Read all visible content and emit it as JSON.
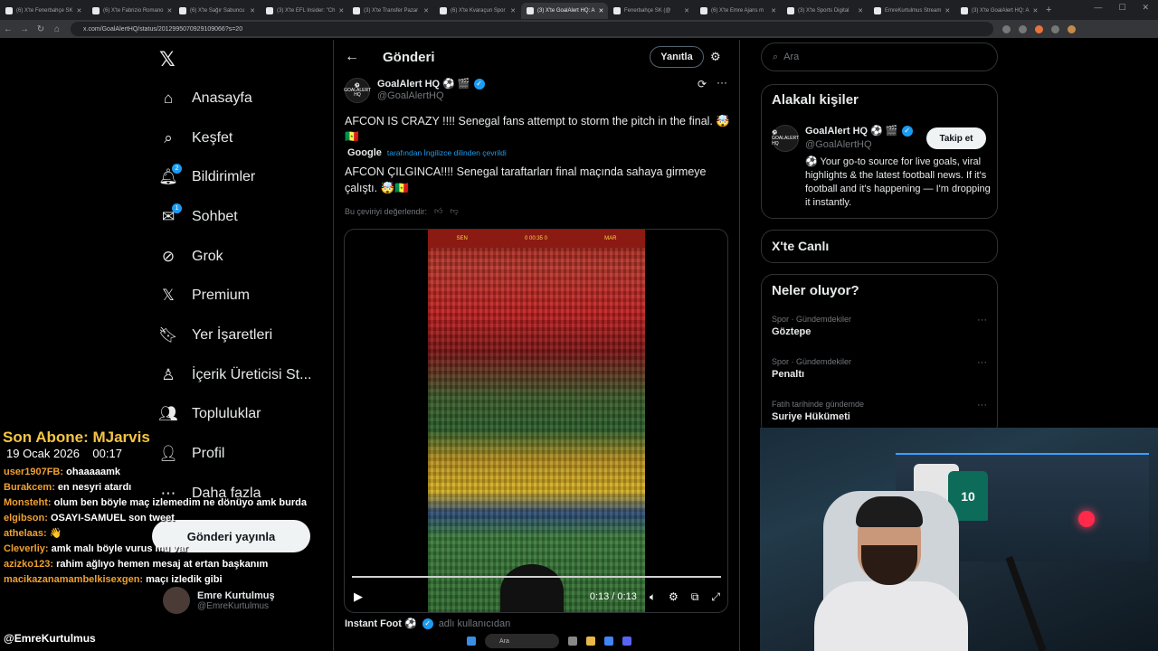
{
  "browser": {
    "tabs": [
      {
        "label": "(6) X'te Fenerbahçe SK"
      },
      {
        "label": "(6) X'te Fabrizio Romano"
      },
      {
        "label": "(6) X'te Sağır Sabuncu"
      },
      {
        "label": "(3) X'te EFL Insider: \"Ch"
      },
      {
        "label": "(3) X'te Transfer Pazar"
      },
      {
        "label": "(6) X'te Kvaraçun Spor"
      },
      {
        "label": "(3) X'te GoalAlert HQ: A",
        "active": true
      },
      {
        "label": "Fenerbahçe SK (@"
      },
      {
        "label": "(6) X'te Emre Ajans m"
      },
      {
        "label": "(3) X'te Sports Digital"
      },
      {
        "label": "EmreKurtulmus Stream"
      },
      {
        "label": "(3) X'te GoalAlert HQ: A"
      }
    ],
    "new_tab": "+",
    "url": "x.com/GoalAlertHQ/status/2012995070929109066?s=20"
  },
  "nav": {
    "logo": "𝕏",
    "items": [
      {
        "label": "Anasayfa",
        "icon": "home-icon"
      },
      {
        "label": "Keşfet",
        "icon": "search-icon"
      },
      {
        "label": "Bildirimler",
        "icon": "bell-icon",
        "badge": "2"
      },
      {
        "label": "Sohbet",
        "icon": "mail-icon",
        "badge": "1"
      },
      {
        "label": "Grok",
        "icon": "grok-icon"
      },
      {
        "label": "Premium",
        "icon": "x-premium-icon"
      },
      {
        "label": "Yer İşaretleri",
        "icon": "bookmark-icon"
      },
      {
        "label": "İçerik Üreticisi St...",
        "icon": "creator-icon"
      },
      {
        "label": "Topluluklar",
        "icon": "communities-icon"
      },
      {
        "label": "Profil",
        "icon": "profile-icon"
      },
      {
        "label": "Daha fazla",
        "icon": "more-circle-icon"
      }
    ],
    "post_button": "Gönderi yayınla",
    "profile": {
      "name": "Emre Kurtulmuş",
      "handle": "@EmreKurtulmus"
    }
  },
  "post": {
    "header_title": "Gönderi",
    "reply_button": "Yanıtla",
    "author_name": "GoalAlert HQ ⚽ 🎬",
    "author_handle": "@GoalAlertHQ",
    "avatar_text": "⚽ GOALALERT HQ",
    "text": "AFCON IS CRAZY !!!! Senegal fans attempt to storm the pitch in the final. 🤯🇸🇳",
    "google_label": "Google",
    "translation_note": "tarafından İngilizce dilinden çevrildi",
    "translated_text": "AFCON ÇILGINCA!!!! Senegal taraftarları final maçında sahaya girmeye çalıştı. 🤯🇸🇳",
    "rate_translation": "Bu çeviriyi değerlendir:",
    "video": {
      "time": "0:13 / 0:13",
      "progress": 1.0,
      "scoreboard_left": "SEN",
      "scoreboard_mid": "0 00:35 0",
      "scoreboard_right": "MAR"
    },
    "next_post_name": "Instant Foot ⚽",
    "next_post_sub": "adlı kullanıcıdan"
  },
  "right": {
    "search_placeholder": "Ara",
    "related_title": "Alakalı kişiler",
    "related_name": "GoalAlert HQ ⚽ 🎬",
    "related_handle": "@GoalAlertHQ",
    "follow_button": "Takip et",
    "related_bio": "⚽ Your go-to source for live goals, viral highlights & the latest football news. If it's football and it's happening — I'm dropping it instantly.",
    "live_title": "X'te Canlı",
    "trend_title": "Neler oluyor?",
    "trends": [
      {
        "category": "Spor · Gündemdekiler",
        "name": "Göztepe"
      },
      {
        "category": "Spor · Gündemdekiler",
        "name": "Penaltı"
      },
      {
        "category": "Fatih tarihinde gündemde",
        "name": "Suriye Hükümeti"
      }
    ]
  },
  "overlay": {
    "sub_title": "Son Abone: MJarvis",
    "date": "19 Ocak 2026",
    "time": "00:17",
    "chat": [
      {
        "user": "user1907FB:",
        "msg": "ohaaaaamk"
      },
      {
        "user": "Burakcem:",
        "msg": "en nesyri atardı"
      },
      {
        "user": "Monsteht:",
        "msg": "olum ben böyle maç izlemedim ne dönüyo amk burda"
      },
      {
        "user": "elgibson:",
        "msg": "OSAYI-SAMUEL son tweet"
      },
      {
        "user": "athelaas:",
        "msg": "👋"
      },
      {
        "user": "Cleverliy:",
        "msg": "amk malı böyle vurus mu var"
      },
      {
        "user": "azizko123:",
        "msg": "rahim ağlıyo hemen mesaj at ertan başkanım"
      },
      {
        "user": "macikazanamambelkisexgen:",
        "msg": "maçı izledik gibi"
      }
    ],
    "streamer_tag": "@EmreKurtulmus",
    "webcam_jersey_number": "10"
  },
  "taskbar": {
    "search_placeholder": "Ara"
  }
}
